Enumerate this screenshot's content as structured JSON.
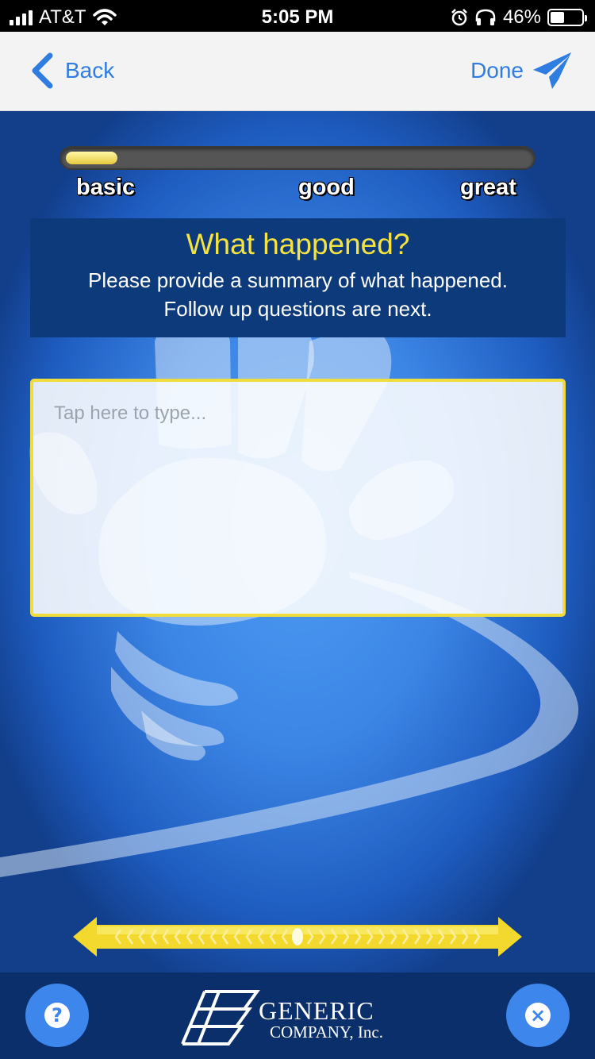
{
  "status_bar": {
    "carrier": "AT&T",
    "time": "5:05 PM",
    "battery_percent": "46%",
    "battery_level": 0.46,
    "icons": [
      "signal-icon",
      "wifi-icon",
      "alarm-icon",
      "headphones-icon",
      "battery-icon"
    ]
  },
  "nav": {
    "back_label": "Back",
    "done_label": "Done",
    "icons": [
      "chevron-left-icon",
      "paper-plane-icon"
    ]
  },
  "progress": {
    "value": 0.11,
    "levels": [
      "basic",
      "good",
      "great"
    ]
  },
  "prompt": {
    "title": "What happened?",
    "line1": "Please provide a summary of what happened.",
    "line2": "Follow up questions are next."
  },
  "input": {
    "placeholder": "Tap here to type..."
  },
  "footer": {
    "help_symbol": "?",
    "close_symbol": "×",
    "logo_line1": "GENERIC",
    "logo_line2": "COMPANY, Inc."
  },
  "colors": {
    "accent": "#2f7de1",
    "title_yellow": "#f5e342",
    "panel_navy": "#0d3a7a",
    "footer_navy": "#0b2f6b"
  }
}
